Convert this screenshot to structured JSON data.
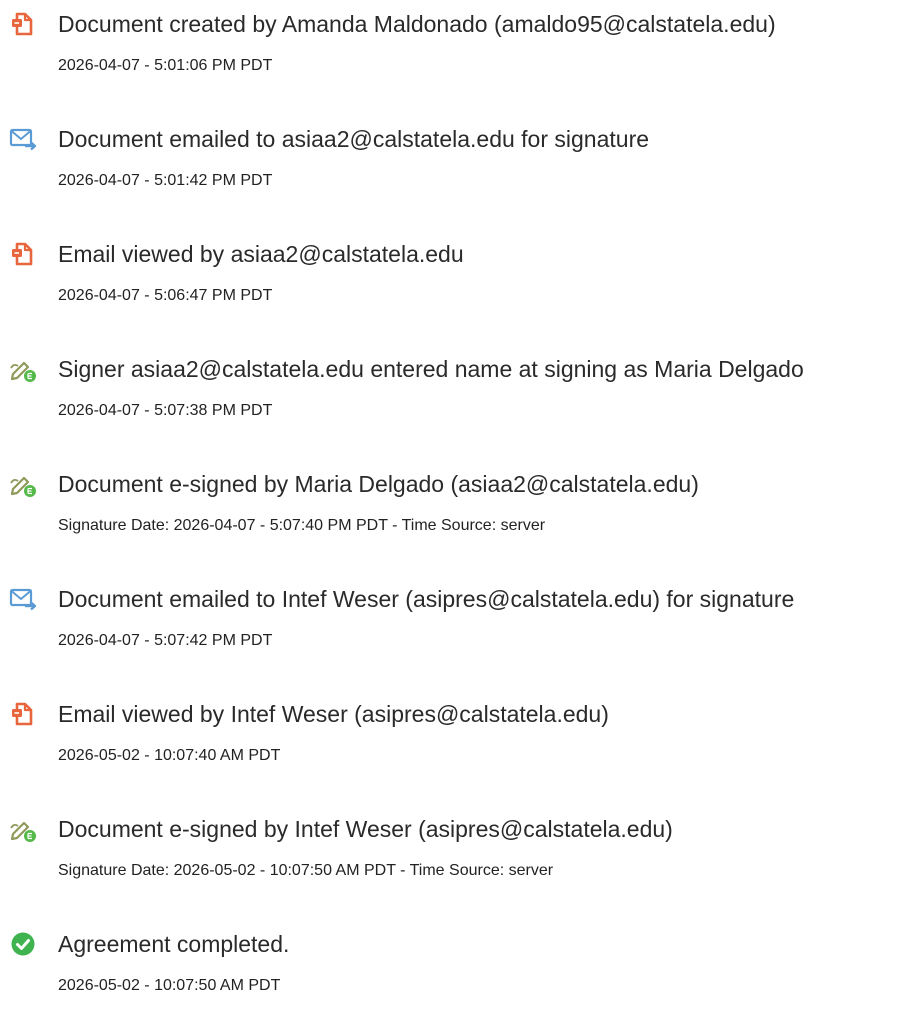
{
  "events": [
    {
      "icon": "document-icon",
      "title": "Document created by Amanda Maldonado (amaldo95@calstatela.edu)",
      "time": "2026-04-07 - 5:01:06 PM PDT"
    },
    {
      "icon": "email-sent-icon",
      "title": "Document emailed to asiaa2@calstatela.edu for signature",
      "time": "2026-04-07 - 5:01:42 PM PDT"
    },
    {
      "icon": "document-icon",
      "title": "Email viewed by asiaa2@calstatela.edu",
      "time": "2026-04-07 - 5:06:47 PM PDT"
    },
    {
      "icon": "e-sign-pen-icon",
      "title": "Signer asiaa2@calstatela.edu entered name at signing as Maria Delgado",
      "time": "2026-04-07 - 5:07:38 PM PDT"
    },
    {
      "icon": "e-sign-pen-icon",
      "title": "Document e-signed by Maria Delgado (asiaa2@calstatela.edu)",
      "time": "Signature Date: 2026-04-07 - 5:07:40 PM PDT - Time Source: server"
    },
    {
      "icon": "email-sent-icon",
      "title": "Document emailed to Intef Weser (asipres@calstatela.edu) for signature",
      "time": "2026-04-07 - 5:07:42 PM PDT"
    },
    {
      "icon": "document-icon",
      "title": "Email viewed by Intef Weser (asipres@calstatela.edu)",
      "time": "2026-05-02 - 10:07:40 AM PDT"
    },
    {
      "icon": "e-sign-pen-icon",
      "title": "Document e-signed by Intef Weser (asipres@calstatela.edu)",
      "time": "Signature Date: 2026-05-02 - 10:07:50 AM PDT - Time Source: server"
    },
    {
      "icon": "check-circle-icon",
      "title": "Agreement completed.",
      "time": "2026-05-02 - 10:07:50 AM PDT"
    }
  ],
  "colors": {
    "document": "#e8663d",
    "email": "#5b9bd5",
    "esign": "#54b948",
    "pen": "#8f9a5a",
    "check": "#3fb34f"
  }
}
